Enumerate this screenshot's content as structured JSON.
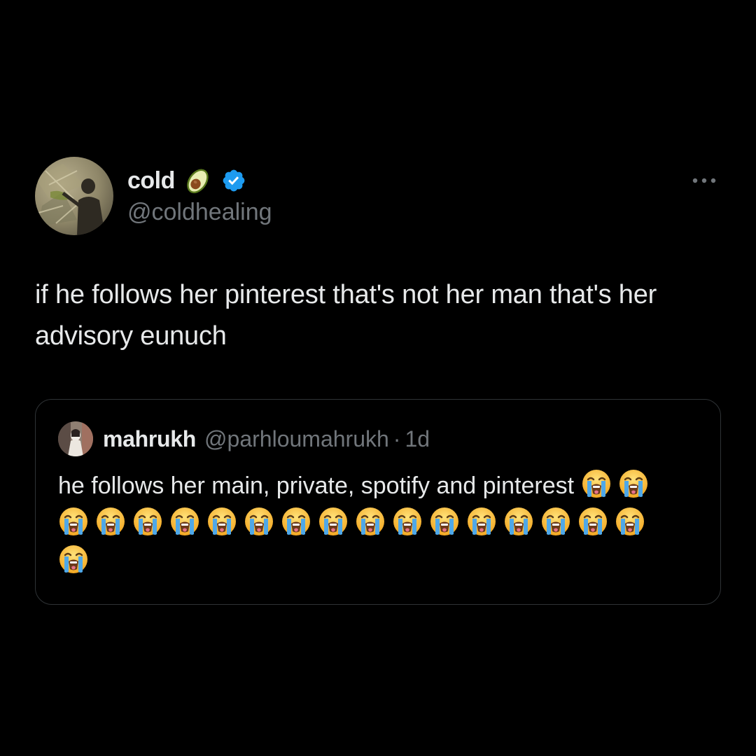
{
  "tweet": {
    "author": {
      "display_name": "cold",
      "name_emoji": "avocado-emoji",
      "verified": true,
      "handle": "@coldhealing",
      "avatar_icon": "user-avatar-photo"
    },
    "text": "if he follows her pinterest that's not her man that's her advisory eunuch",
    "more_icon": "more-options-icon"
  },
  "quote": {
    "author": {
      "display_name": "mahrukh",
      "handle": "@parhloumahrukh",
      "separator": "·",
      "time": "1d",
      "avatar_icon": "user-avatar-photo"
    },
    "text": "he follows her main, private, spotify and pinterest",
    "emoji": "loudly-crying-face-emoji",
    "emoji_count": 19
  },
  "colors": {
    "background": "#000000",
    "text_primary": "#e7e9ea",
    "text_secondary": "#71767b",
    "border": "#2f3336",
    "verified_badge": "#1d9bf0"
  }
}
